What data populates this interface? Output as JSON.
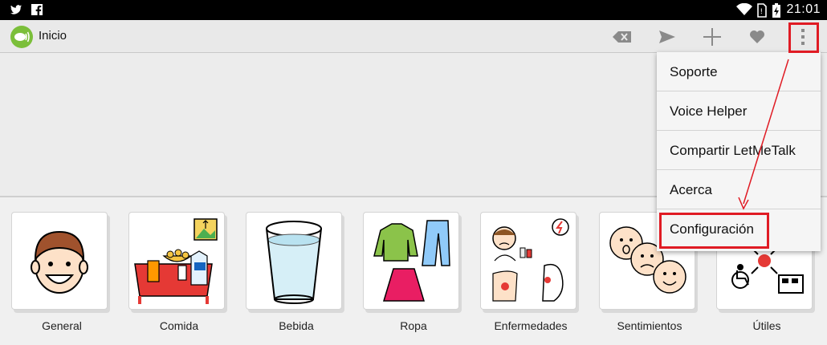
{
  "status_bar": {
    "time": "21:01",
    "left_icons": [
      "twitter-icon",
      "facebook-icon"
    ],
    "right_icons": [
      "wifi-icon",
      "no-sim-icon",
      "battery-charging-icon"
    ]
  },
  "action_bar": {
    "title": "Inicio",
    "actions": [
      "backspace-icon",
      "send-icon",
      "add-icon",
      "favorite-icon",
      "overflow-menu-icon"
    ]
  },
  "categories": [
    {
      "label": "General",
      "icon": "boy-face-icon"
    },
    {
      "label": "Comida",
      "icon": "food-table-icon"
    },
    {
      "label": "Bebida",
      "icon": "glass-of-water-icon"
    },
    {
      "label": "Ropa",
      "icon": "clothes-icon"
    },
    {
      "label": "Enfermedades",
      "icon": "illness-icon"
    },
    {
      "label": "Sentimientos",
      "icon": "feelings-faces-icon"
    },
    {
      "label": "Útiles",
      "icon": "utilities-icon"
    }
  ],
  "menu": {
    "items": [
      {
        "label": "Soporte"
      },
      {
        "label": "Voice Helper"
      },
      {
        "label": "Compartir LetMeTalk"
      },
      {
        "label": "Acerca"
      },
      {
        "label": "Configuración"
      }
    ]
  },
  "colors": {
    "annotation": "#e01b24",
    "logo": "#7bbf3a",
    "action_icon": "#8a8a8a"
  }
}
